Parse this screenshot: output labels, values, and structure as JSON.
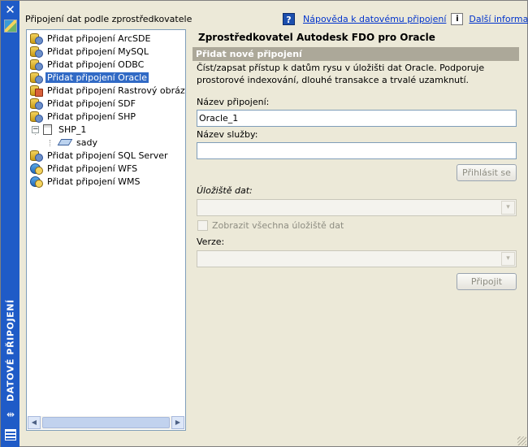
{
  "palette": {
    "title": "DATOVÉ PŘIPOJENÍ",
    "close_glyph": "✕",
    "autohide_glyph": "⇹"
  },
  "left_panel": {
    "caption": "Připojení dat podle zprostředkovatele",
    "tree": [
      {
        "label": "Přidat připojení ArcSDE"
      },
      {
        "label": "Přidat připojení MySQL"
      },
      {
        "label": "Přidat připojení ODBC"
      },
      {
        "label": "Přidat připojení Oracle"
      },
      {
        "label": "Přidat připojení Rastrový obrázek nebo DEM"
      },
      {
        "label": "Přidat připojení SDF"
      },
      {
        "label": "Přidat připojení SHP"
      },
      {
        "label": "SHP_1"
      },
      {
        "label": "sady"
      },
      {
        "label": "Přidat připojení SQL Server"
      },
      {
        "label": "Přidat připojení WFS"
      },
      {
        "label": "Přidat připojení WMS"
      }
    ],
    "expander_glyph": "−"
  },
  "help": {
    "icon_glyph": "?",
    "help_link": "Nápověda k datovému připojení",
    "info_glyph": "i",
    "more_link": "Další informace"
  },
  "main": {
    "provider_title": "Zprostředkovatel Autodesk FDO pro Oracle",
    "section_header": "Přidat nové připojení",
    "description": "Číst/zapsat přístup k datům rysu v úložišti dat Oracle. Podporuje prostorové indexování, dlouhé transakce a trvalé uzamknutí.",
    "connection_name_label": "Název připojení:",
    "connection_name_value": "Oracle_1",
    "service_name_label": "Název služby:",
    "service_name_value": "",
    "login_button": "Přihlásit se",
    "datastore_label": "Úložiště dat:",
    "show_all_label": "Zobrazit všechna úložiště dat",
    "version_label": "Verze:",
    "connect_button": "Připojit",
    "dropdown_glyph": "▾"
  }
}
